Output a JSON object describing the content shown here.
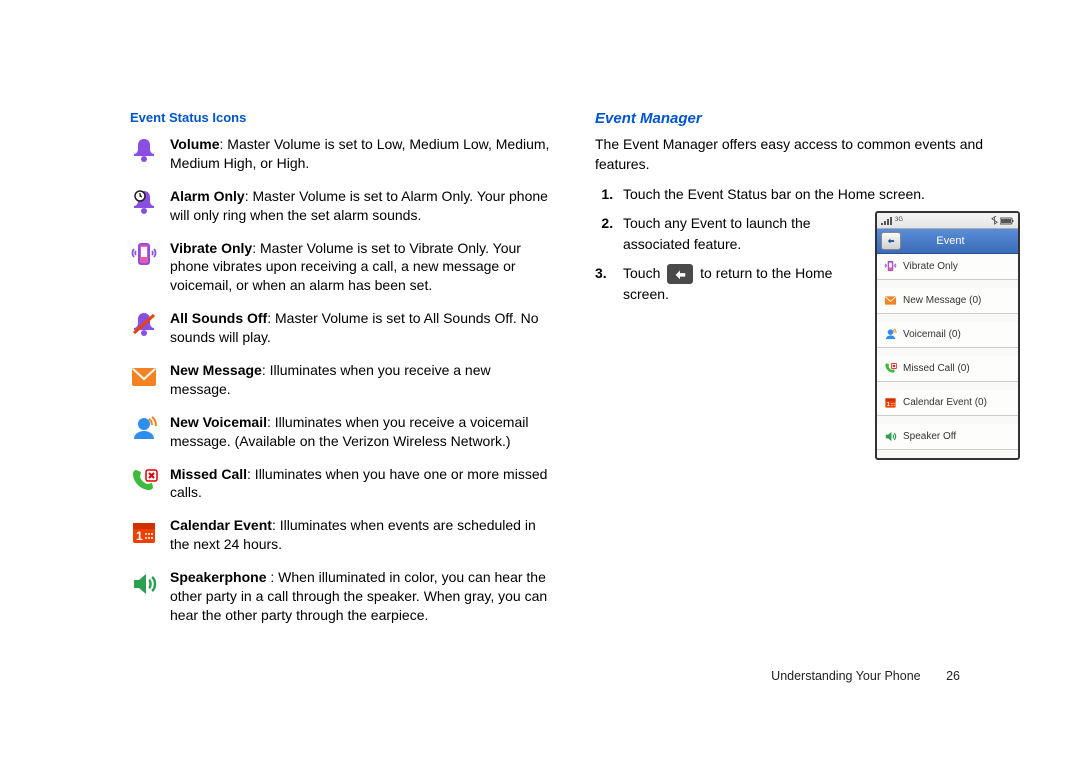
{
  "left": {
    "heading": "Event Status Icons",
    "items": [
      {
        "icon": "volume",
        "bold": "Volume",
        "text": ": Master Volume is set to Low, Medium Low, Medium, Medium High, or High."
      },
      {
        "icon": "alarm",
        "bold": "Alarm Only",
        "text": ": Master Volume is set to Alarm Only.  Your phone will only ring when the set alarm sounds."
      },
      {
        "icon": "vibrate",
        "bold": "Vibrate Only",
        "text": ": Master Volume is set to Vibrate Only. Your phone vibrates upon receiving a call, a new message or voicemail, or when an alarm has been set."
      },
      {
        "icon": "soundsoff",
        "bold": "All Sounds Off",
        "text": ": Master Volume is set to All Sounds Off. No sounds will play."
      },
      {
        "icon": "message",
        "bold": "New Message",
        "text": ": Illuminates when you receive a new message."
      },
      {
        "icon": "voicemail",
        "bold": "New Voicemail",
        "text": ": Illuminates when you receive a voicemail message. (Available on the Verizon Wireless Network.)"
      },
      {
        "icon": "missed",
        "bold": "Missed Call",
        "text": ": Illuminates when you have one or more missed calls."
      },
      {
        "icon": "calendar",
        "bold": "Calendar Event",
        "text": ": Illuminates when events are scheduled in the next 24 hours."
      },
      {
        "icon": "speaker",
        "bold": "Speakerphone ",
        "text": ": When illuminated in color, you can hear the other party in a call through the speaker. When gray, you can hear the other party through the earpiece."
      }
    ]
  },
  "right": {
    "heading": "Event Manager",
    "intro": "The Event Manager offers easy access to common events and features.",
    "steps": {
      "s1": "Touch the Event Status bar on the Home screen.",
      "s2": "Touch any Event to launch the associated feature.",
      "s3a": "Touch ",
      "s3b": " to return to the Home screen."
    },
    "phone": {
      "header_title": "Event",
      "items": [
        {
          "icon": "vibrate",
          "label": "Vibrate Only"
        },
        {
          "icon": "message",
          "label": "New Message (0)"
        },
        {
          "icon": "voicemail",
          "label": "Voicemail (0)"
        },
        {
          "icon": "missed",
          "label": "Missed Call (0)"
        },
        {
          "icon": "calendar",
          "label": "Calendar Event (0)"
        },
        {
          "icon": "speaker",
          "label": "Speaker Off"
        }
      ]
    }
  },
  "footer": {
    "section": "Understanding Your Phone",
    "page": "26"
  }
}
